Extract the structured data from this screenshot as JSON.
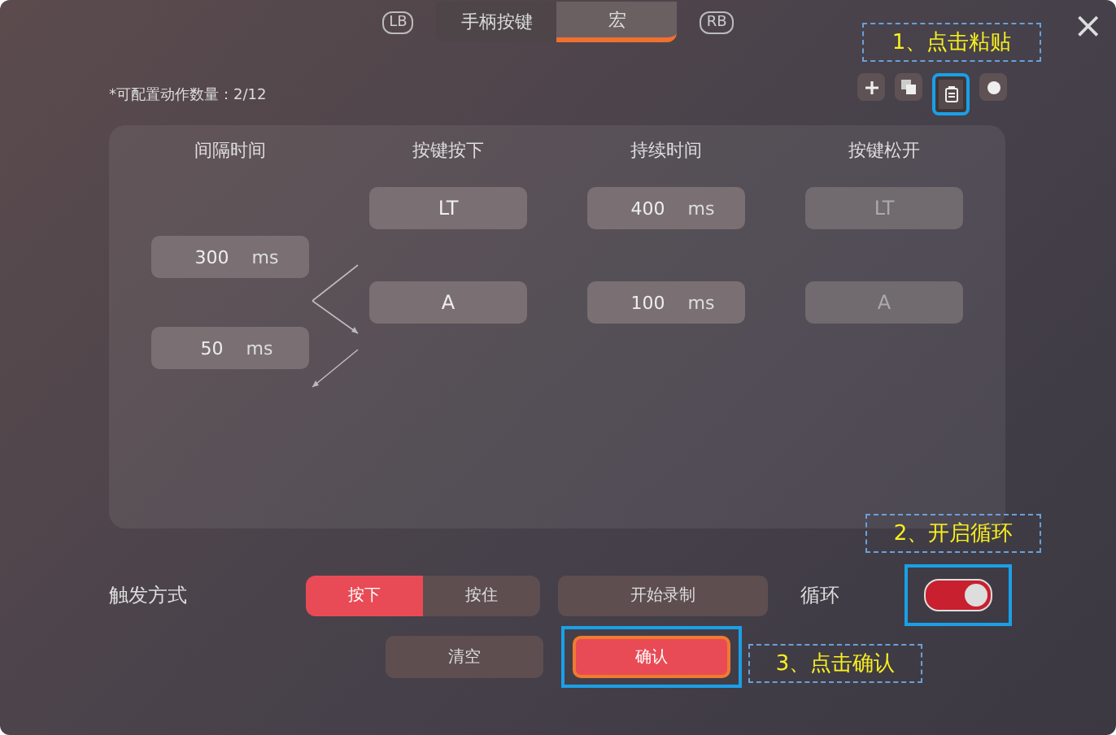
{
  "bumper_left": "LB",
  "bumper_right": "RB",
  "tabs": [
    {
      "label": "手柄按键",
      "selected": false
    },
    {
      "label": "宏",
      "selected": true
    }
  ],
  "close": "×",
  "action_count": "*可配置动作数量：2/12",
  "toolbar": [
    {
      "kind": "add",
      "highlighted": false
    },
    {
      "kind": "copy",
      "highlighted": false
    },
    {
      "kind": "paste",
      "highlighted": true
    },
    {
      "kind": "record",
      "highlighted": false
    }
  ],
  "columns": [
    "间隔时间",
    "按键按下",
    "持续时间",
    "按键松开"
  ],
  "intervals": [
    {
      "value": "300",
      "unit": "ms"
    },
    {
      "value": "50",
      "unit": "ms"
    }
  ],
  "actions": [
    {
      "press": "LT",
      "duration": "400",
      "unit": "ms",
      "release": "LT"
    },
    {
      "press": "A",
      "duration": "100",
      "unit": "ms",
      "release": "A"
    }
  ],
  "trigger": {
    "label": "触发方式",
    "options": [
      {
        "label": "按下",
        "selected": true
      },
      {
        "label": "按住",
        "selected": false
      }
    ]
  },
  "record_button": "开始录制",
  "loop": {
    "label": "循环",
    "on": true,
    "highlighted": true
  },
  "buttons": [
    {
      "label": "清空",
      "kind": "secondary",
      "highlighted": false
    },
    {
      "label": "确认",
      "kind": "primary",
      "highlighted": true
    }
  ],
  "annotations": [
    {
      "text": "1、点击粘贴",
      "kind": "paste"
    },
    {
      "text": "2、开启循环",
      "kind": "loop"
    },
    {
      "text": "3、点击确认",
      "kind": "confirm"
    }
  ]
}
